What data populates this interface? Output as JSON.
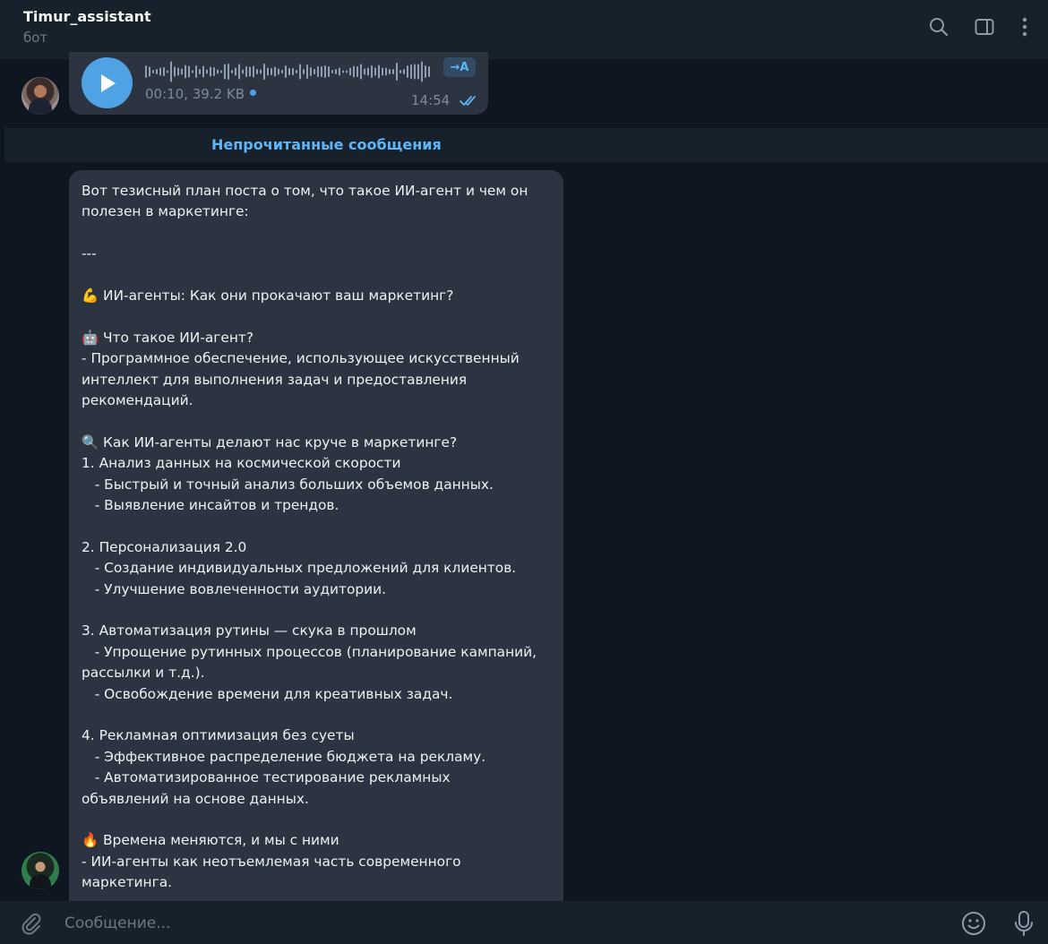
{
  "header": {
    "title": "Timur_assistant",
    "subtitle": "бот"
  },
  "voice_message": {
    "meta": "00:10, 39.2 KB",
    "transcribe_label": "→A",
    "time": "14:54"
  },
  "unread_divider": "Непрочитанные сообщения",
  "message": {
    "lines": [
      {
        "text": "Вот тезисный план поста о том, что такое ИИ-агент и чем он"
      },
      {
        "text": "полезен в маркетинге:"
      },
      {
        "text": ""
      },
      {
        "text": "---"
      },
      {
        "text": ""
      },
      {
        "emoji": "💪",
        "text": "ИИ-агенты: Как они прокачают ваш маркетинг?"
      },
      {
        "text": ""
      },
      {
        "emoji": "🤖",
        "text": "Что такое ИИ-агент?"
      },
      {
        "text": "- Программное обеспечение, использующее искусственный"
      },
      {
        "text": "интеллект для выполнения задач и предоставления"
      },
      {
        "text": "рекомендаций."
      },
      {
        "text": ""
      },
      {
        "emoji": "🔍",
        "text": "Как ИИ-агенты делают нас круче в маркетинге?"
      },
      {
        "text": "1. Анализ данных на космической скорости"
      },
      {
        "text": "   - Быстрый и точный анализ больших объемов данных."
      },
      {
        "text": "   - Выявление инсайтов и трендов."
      },
      {
        "text": ""
      },
      {
        "text": "2. Персонализация 2.0"
      },
      {
        "text": "   - Создание индивидуальных предложений для клиентов."
      },
      {
        "text": "   - Улучшение вовлеченности аудитории."
      },
      {
        "text": ""
      },
      {
        "text": "3. Автоматизация рутины — скука в прошлом"
      },
      {
        "text": "   - Упрощение рутинных процессов (планирование кампаний,"
      },
      {
        "text": "рассылки и т.д.)."
      },
      {
        "text": "   - Освобождение времени для креативных задач."
      },
      {
        "text": ""
      },
      {
        "text": "4. Рекламная оптимизация без суеты"
      },
      {
        "text": "   - Эффективное распределение бюджета на рекламу."
      },
      {
        "text": "   - Автоматизированное тестирование рекламных"
      },
      {
        "text": "объявлений на основе данных."
      },
      {
        "text": ""
      },
      {
        "emoji": "🔥",
        "text": "Времена меняются, и мы с ними"
      },
      {
        "text": "- ИИ-агенты как неотъемлемая часть современного"
      },
      {
        "text": "маркетинга."
      }
    ]
  },
  "composer": {
    "placeholder": "Сообщение..."
  },
  "icons": {
    "search": "search-icon",
    "sidebar": "sidebar-toggle-icon",
    "more": "more-vertical-icon",
    "attach": "paperclip-icon",
    "emoji": "emoji-icon",
    "mic": "microphone-icon",
    "play": "play-icon"
  },
  "colors": {
    "background": "#0e1621",
    "panel": "#17212b",
    "bubble": "#2b3440",
    "accent": "#4fa2e3",
    "link": "#5eb5f7"
  }
}
